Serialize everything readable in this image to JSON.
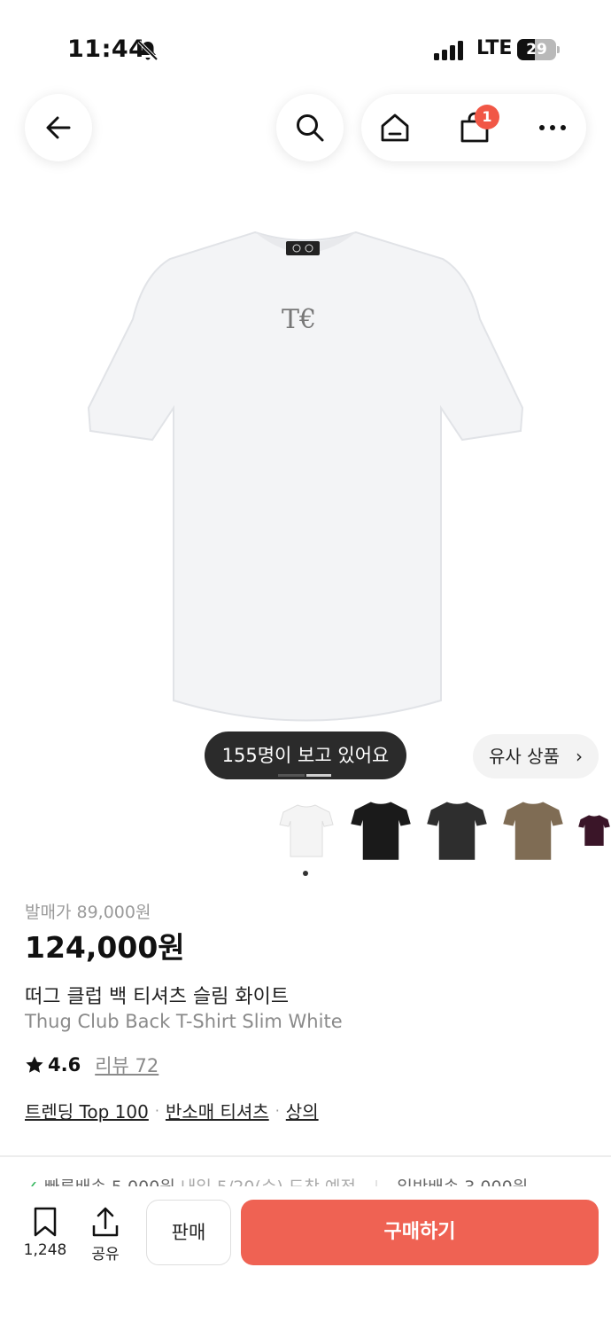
{
  "status_bar": {
    "time": "11:44",
    "network": "LTE",
    "battery": "29"
  },
  "nav": {
    "cart_count": "1"
  },
  "product": {
    "viewers_text": "155명이 보고 있어요",
    "similar_label": "유사 상품",
    "release_price": "발매가 89,000원",
    "price": "124,000원",
    "name_ko": "떠그 클럽 백 티셔츠 슬림 화이트",
    "name_en": "Thug Club Back T-Shirt Slim White",
    "rating": "4.6",
    "reviews": "리뷰 72",
    "tags": [
      "트렌딩 Top 100",
      "반소매 티셔츠",
      "상의"
    ],
    "shipping_text": "빠른배송 5,000원",
    "shipping_date": "내일 5/20(수) 도착 예정",
    "shipping_alt": "일반배송 3,000원"
  },
  "color_options": [
    {
      "name": "white",
      "color": "#f4f4f4"
    },
    {
      "name": "black",
      "color": "#1a1a1a"
    },
    {
      "name": "charcoal",
      "color": "#2e2e2e"
    },
    {
      "name": "khaki",
      "color": "#7f6c54"
    },
    {
      "name": "burgundy",
      "color": "#3a1528"
    }
  ],
  "bottom_bar": {
    "bookmark_count": "1,248",
    "share_label": "공유",
    "sell_label": "판매",
    "buy_label": "구매하기"
  },
  "colors": {
    "accent": "#ef6253",
    "badge": "#f15746"
  }
}
